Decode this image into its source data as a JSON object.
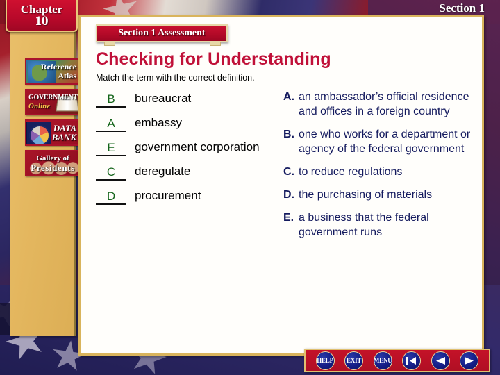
{
  "chapter": {
    "word": "Chapter",
    "number": "10"
  },
  "section_label": "Section 1",
  "banner": {
    "title": "Section 1 Assessment"
  },
  "header": {
    "title": "Checking for Understanding",
    "instruction": "Match the term with the correct definition."
  },
  "terms": [
    {
      "answer": "B",
      "label": "bureaucrat"
    },
    {
      "answer": "A",
      "label": "embassy"
    },
    {
      "answer": "E",
      "label": "government corporation"
    },
    {
      "answer": "C",
      "label": "deregulate"
    },
    {
      "answer": "D",
      "label": "procurement"
    }
  ],
  "definitions": [
    {
      "letter": "A.",
      "text": "an ambassador’s official residence and offices in a foreign country"
    },
    {
      "letter": "B.",
      "text": "one who works for a department or agency of the federal government"
    },
    {
      "letter": "C.",
      "text": "to reduce regulations"
    },
    {
      "letter": "D.",
      "text": "the purchasing of materials"
    },
    {
      "letter": "E.",
      "text": "a business that the federal government runs"
    }
  ],
  "sidebar": {
    "buttons": [
      {
        "name": "reference-atlas",
        "line1": "Reference",
        "line2": "Atlas"
      },
      {
        "name": "government-online",
        "line1": "GOVERNMENT",
        "line2": "Online"
      },
      {
        "name": "data-bank",
        "line1": "DATA",
        "line2": "BANK"
      },
      {
        "name": "gallery-of-presidents",
        "line1": "Gallery of",
        "line2": "Presidents"
      }
    ]
  },
  "navbar": {
    "help": "HELP",
    "exit": "EXIT",
    "menu": "MENU",
    "icons": [
      "first-page-arrow-icon",
      "back-arrow-icon",
      "forward-arrow-icon"
    ]
  },
  "colors": {
    "crimson": "#c01038",
    "navy": "#141a5e",
    "green": "#15651b",
    "gold": "#d9b45c",
    "sidebar_gold": "#e4b75f"
  }
}
